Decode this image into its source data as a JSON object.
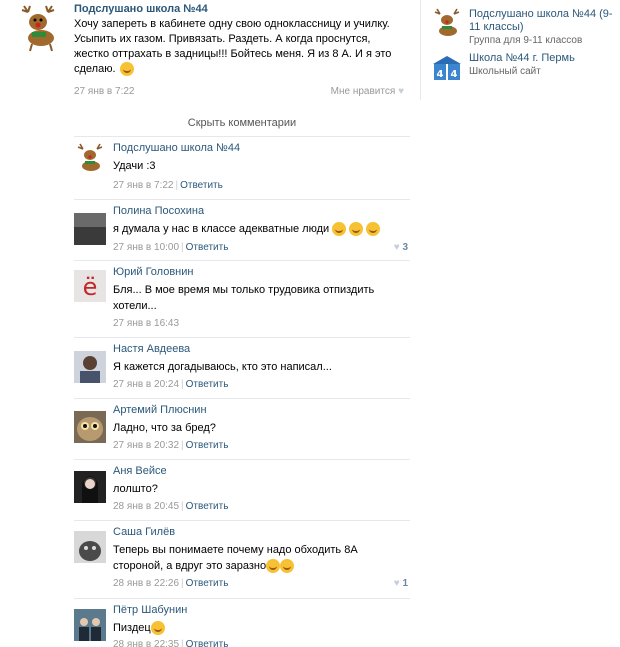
{
  "post": {
    "author": "Подслушано школа №44",
    "text": "Хочу запереть в кабинете одну свою одноклассницу и училку. Усыпить их газом. Привязать. Раздеть. А когда проснутся, жестко оттрахать в задницы!!! Бойтесь меня. Я из 8 А. И я это сделаю.",
    "date": "27 янв в 7:22",
    "like_label": "Мне нравится"
  },
  "sidebar": {
    "groups": [
      {
        "name": "Подслушано школа №44 (9-11 классы)",
        "subtitle": "Группа для 9-11 классов"
      },
      {
        "name": "Школа №44 г. Пермь",
        "subtitle": "Школьный сайт"
      }
    ]
  },
  "comments_toggle": "Скрыть комментарии",
  "comments": [
    {
      "author": "Подслушано школа №44",
      "text": "Удачи :3",
      "date": "27 янв в 7:22",
      "reply": "Ответить",
      "likes": ""
    },
    {
      "author": "Полина Посохина",
      "text": "я думала у нас в классе адекватные люди",
      "date": "27 янв в 10:00",
      "reply": "Ответить",
      "likes": "3"
    },
    {
      "author": "Юрий Головнин",
      "text": "Бля... В мое время мы только трудовика отпиздить хотели...",
      "date": "27 янв в 16:43",
      "reply": "",
      "likes": ""
    },
    {
      "author": "Настя Авдеева",
      "text": "Я кажется догадываюсь, кто это написал...",
      "date": "27 янв в 20:24",
      "reply": "Ответить",
      "likes": ""
    },
    {
      "author": "Артемий Плюснин",
      "text": "Ладно, что за бред?",
      "date": "27 янв в 20:32",
      "reply": "Ответить",
      "likes": ""
    },
    {
      "author": "Аня Вейсе",
      "text": "лолшто?",
      "date": "28 янв в 20:45",
      "reply": "Ответить",
      "likes": ""
    },
    {
      "author": "Саша Гилёв",
      "text": "Теперь вы понимаете почему надо обходить 8А стороной, а вдруг это заразно",
      "date": "28 янв в 22:26",
      "reply": "Ответить",
      "likes": "1"
    },
    {
      "author": "Пётр Шабунин",
      "text": "Пиздец",
      "date": "28 янв в 22:35",
      "reply": "Ответить",
      "likes": ""
    }
  ]
}
